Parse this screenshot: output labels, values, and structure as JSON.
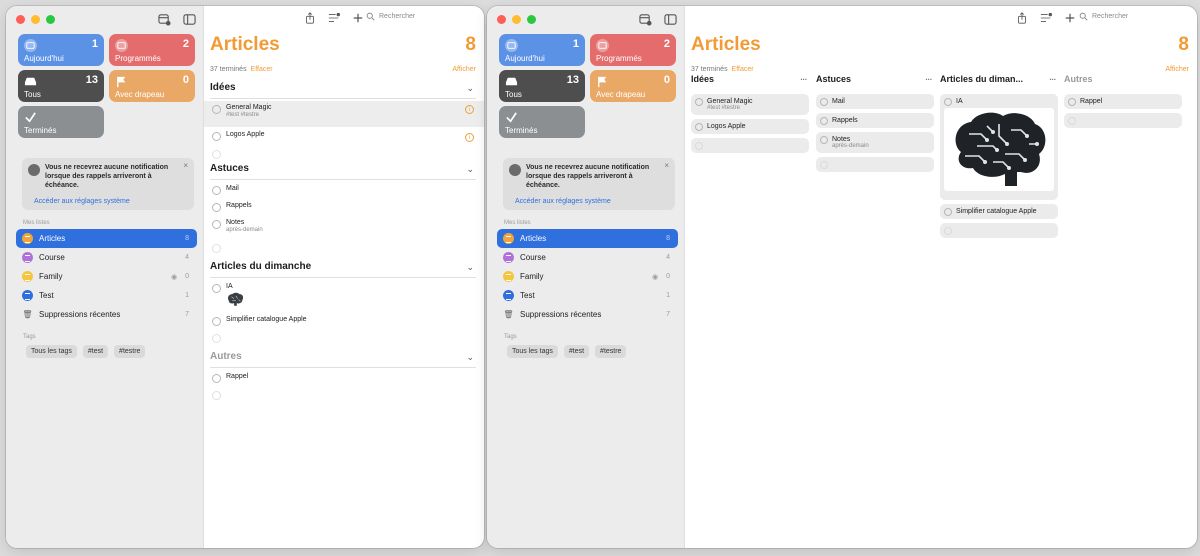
{
  "sidebar": {
    "cards": [
      {
        "label": "Aujourd'hui",
        "count": "1",
        "color": "#5b92e6"
      },
      {
        "label": "Programmés",
        "count": "2",
        "color": "#e46c6c"
      },
      {
        "label": "Tous",
        "count": "13",
        "color": "#4e4e4e"
      },
      {
        "label": "Avec drapeau",
        "count": "0",
        "color": "#eaa867"
      },
      {
        "label": "Terminés",
        "count": "",
        "color": "#8c8f92"
      }
    ],
    "notice": {
      "text": "Vous ne recevrez aucune notification lorsque des rappels arriveront à échéance.",
      "close": "×",
      "link": "Accéder aux réglages système"
    },
    "lists_title": "Mes listes",
    "lists": [
      {
        "name": "Articles",
        "count": "8",
        "color": "#f0a53b"
      },
      {
        "name": "Course",
        "count": "4",
        "color": "#b071d9"
      },
      {
        "name": "Family",
        "count": "0",
        "color": "#f4c63f"
      },
      {
        "name": "Test",
        "count": "1",
        "color": "#2f6fde"
      },
      {
        "name": "Suppressions récentes",
        "count": "7"
      }
    ],
    "tags_title": "Tags",
    "tags": [
      "Tous les tags",
      "#test",
      "#testre"
    ]
  },
  "toolbar": {
    "search_placeholder": "Rechercher"
  },
  "main": {
    "title": "Articles",
    "count": "8",
    "completed_text": "37 terminés",
    "clear_label": "Effacer",
    "show_label": "Afficher",
    "more_label": "...",
    "chevron": "⌄",
    "flag_symbol": "i",
    "sections": [
      {
        "title": "Idées",
        "items": [
          {
            "title": "General Magic",
            "sub": "#test #testre"
          },
          {
            "title": "Logos Apple"
          }
        ]
      },
      {
        "title": "Astuces",
        "items": [
          {
            "title": "Mail"
          },
          {
            "title": "Rappels"
          },
          {
            "title": "Notes",
            "sub": "après-demain"
          }
        ]
      },
      {
        "title": "Articles du dimanche",
        "items": [
          {
            "title": "IA"
          },
          {
            "title": "Simplifier catalogue Apple"
          }
        ]
      },
      {
        "title": "Autres",
        "items": [
          {
            "title": "Rappel"
          }
        ]
      }
    ],
    "column_titles": [
      "Idées",
      "Astuces",
      "Articles du diman...",
      "Autres"
    ]
  }
}
